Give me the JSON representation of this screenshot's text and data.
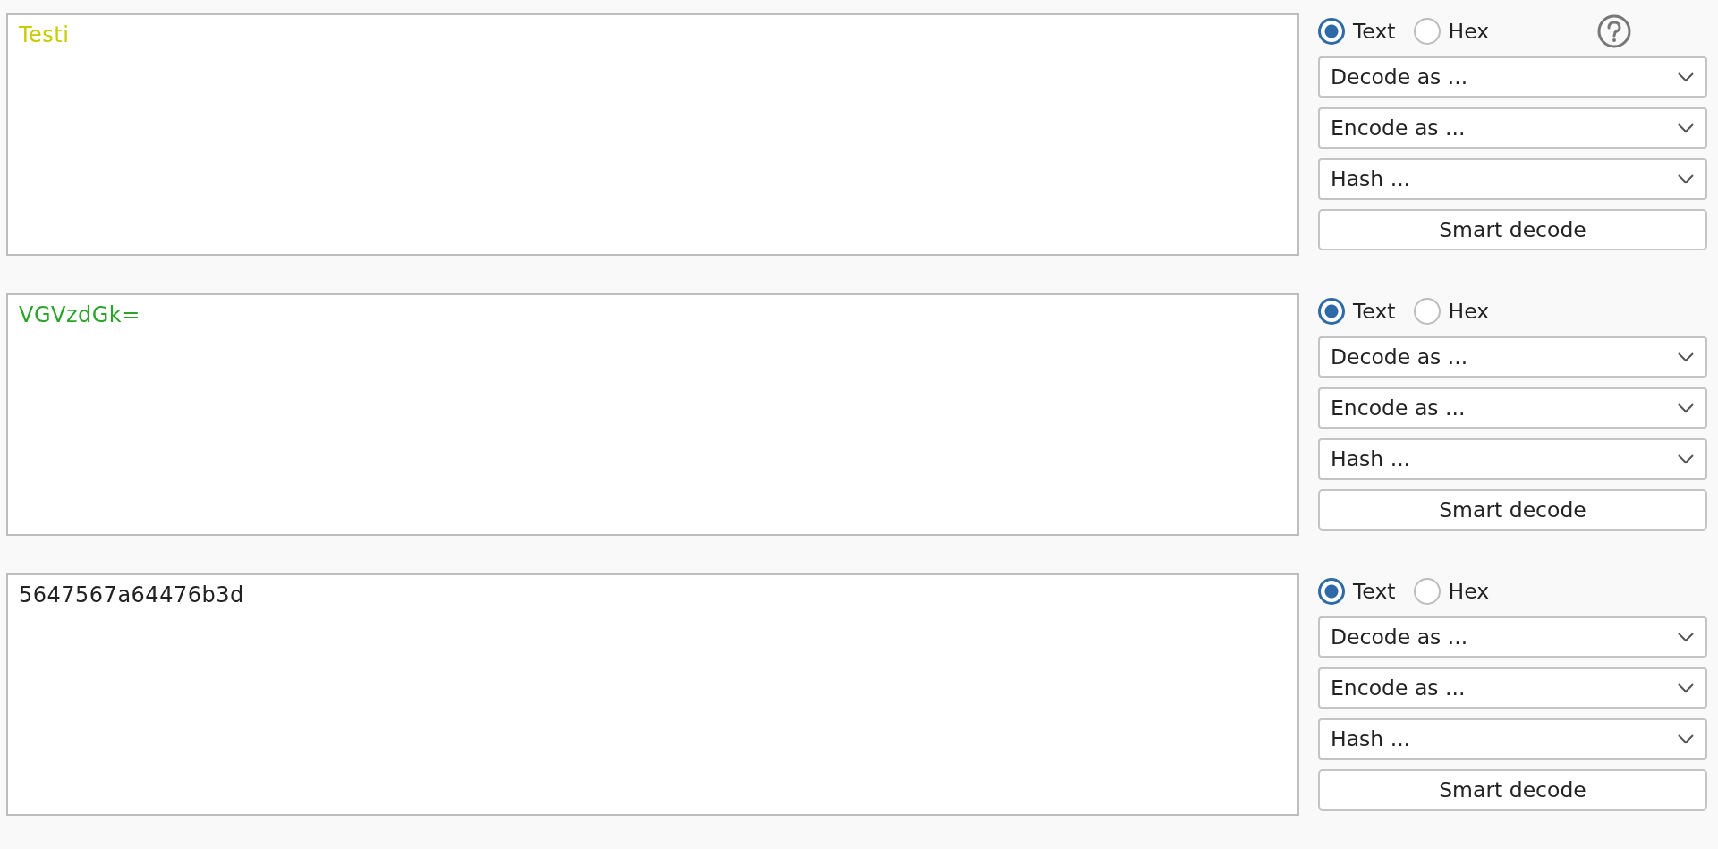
{
  "panels": [
    {
      "content": "Testi",
      "color": "#c8cc00",
      "modes": [
        {
          "label": "Text",
          "selected": true
        },
        {
          "label": "Hex",
          "selected": false
        }
      ],
      "help": true,
      "dropdowns": [
        "Decode as ...",
        "Encode as ...",
        "Hash ..."
      ],
      "button": "Smart decode"
    },
    {
      "content": "VGVzdGk=",
      "color": "#2aa52a",
      "modes": [
        {
          "label": "Text",
          "selected": true
        },
        {
          "label": "Hex",
          "selected": false
        }
      ],
      "help": false,
      "dropdowns": [
        "Decode as ...",
        "Encode as ...",
        "Hash ..."
      ],
      "button": "Smart decode"
    },
    {
      "content": "5647567a64476b3d",
      "color": "#222222",
      "modes": [
        {
          "label": "Text",
          "selected": true
        },
        {
          "label": "Hex",
          "selected": false
        }
      ],
      "help": false,
      "dropdowns": [
        "Decode as ...",
        "Encode as ...",
        "Hash ..."
      ],
      "button": "Smart decode"
    }
  ]
}
